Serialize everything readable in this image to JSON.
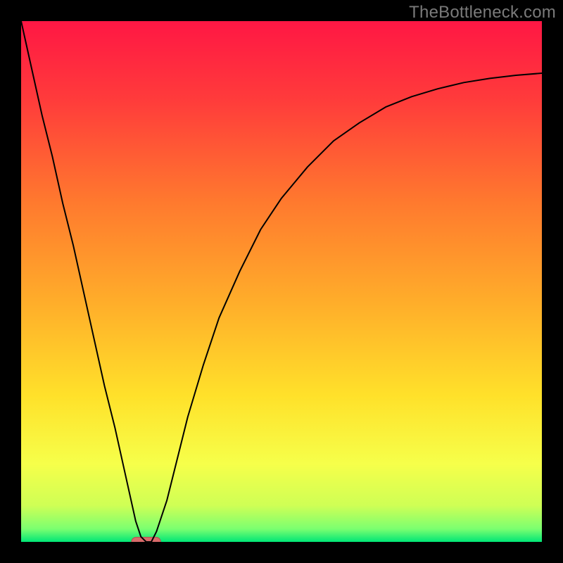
{
  "watermark": "TheBottleneck.com",
  "colors": {
    "frame": "#000000",
    "curve": "#000000",
    "marker_fill": "#d86a6a",
    "marker_stroke": "#b94f4f"
  },
  "chart_data": {
    "type": "line",
    "title": "",
    "xlabel": "",
    "ylabel": "",
    "xlim": [
      0,
      100
    ],
    "ylim": [
      0,
      100
    ],
    "grid": false,
    "legend": false,
    "gradient_stops": [
      {
        "offset": 0.0,
        "color": "#ff1744"
      },
      {
        "offset": 0.15,
        "color": "#ff3b3b"
      },
      {
        "offset": 0.35,
        "color": "#ff7a2e"
      },
      {
        "offset": 0.55,
        "color": "#ffb02a"
      },
      {
        "offset": 0.72,
        "color": "#ffe12a"
      },
      {
        "offset": 0.85,
        "color": "#f6ff4a"
      },
      {
        "offset": 0.93,
        "color": "#cfff55"
      },
      {
        "offset": 0.975,
        "color": "#7bff70"
      },
      {
        "offset": 1.0,
        "color": "#00e676"
      }
    ],
    "series": [
      {
        "name": "curve",
        "x": [
          0,
          2,
          4,
          6,
          8,
          10,
          12,
          14,
          16,
          18,
          20,
          22,
          23,
          24,
          25,
          26,
          28,
          30,
          32,
          35,
          38,
          42,
          46,
          50,
          55,
          60,
          65,
          70,
          75,
          80,
          85,
          90,
          95,
          100
        ],
        "y": [
          100,
          91,
          82,
          74,
          65,
          57,
          48,
          39,
          30,
          22,
          13,
          4,
          1,
          0,
          0,
          2,
          8,
          16,
          24,
          34,
          43,
          52,
          60,
          66,
          72,
          77,
          80.5,
          83.5,
          85.5,
          87,
          88.2,
          89,
          89.6,
          90
        ]
      }
    ],
    "marker": {
      "x": 24,
      "y": 0,
      "rx": 2.8,
      "ry": 0.9
    }
  }
}
